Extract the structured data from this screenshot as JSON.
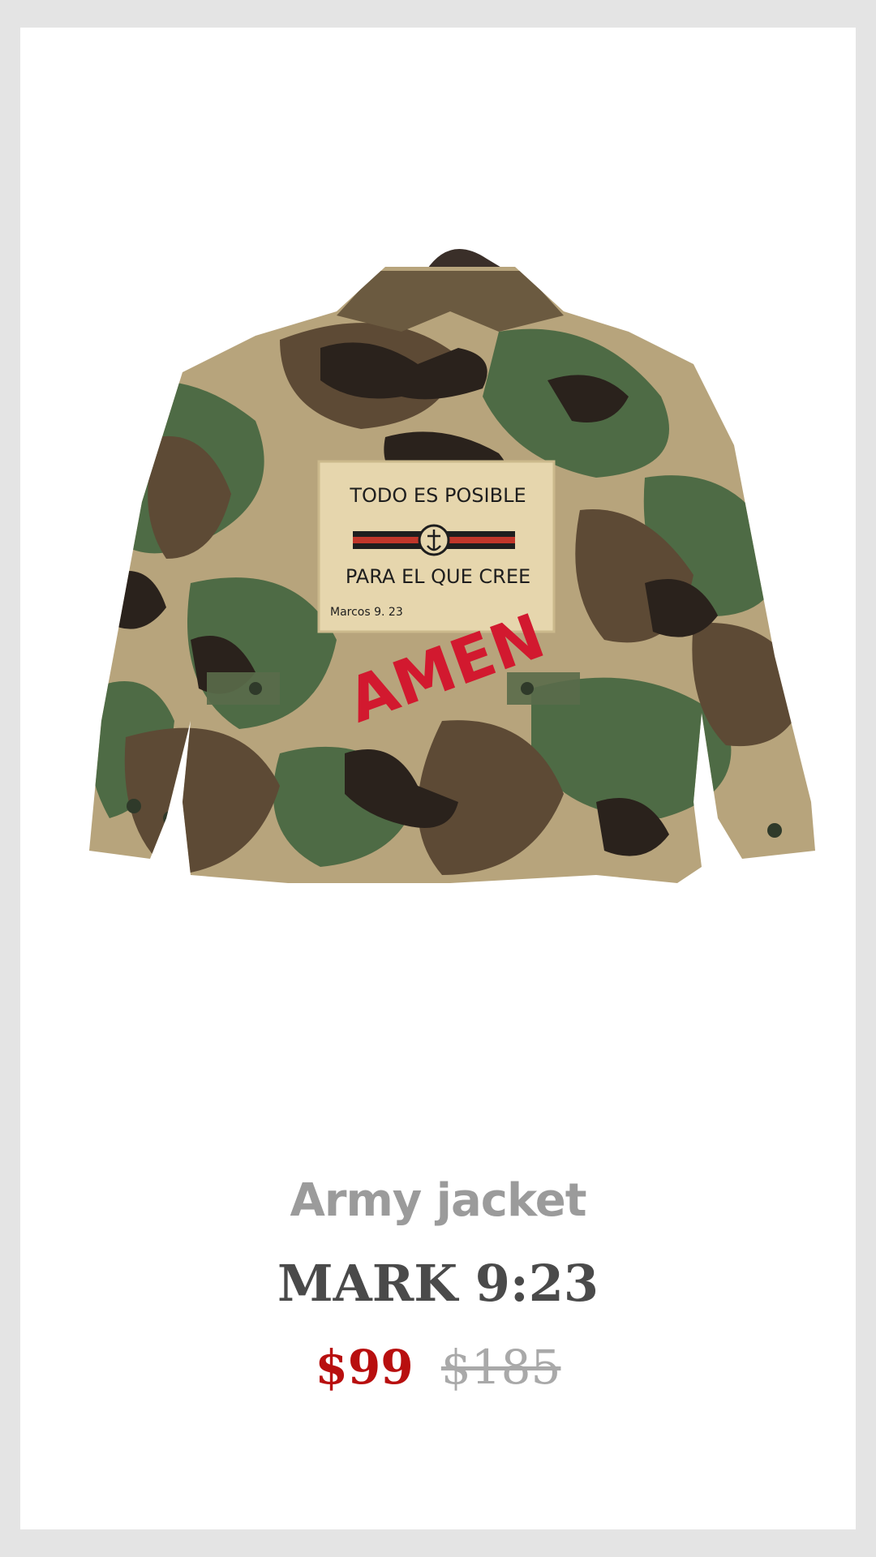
{
  "product": {
    "category": "Army jacket",
    "title": "MARK 9:23",
    "price": "$99",
    "original_price": "$185",
    "image": {
      "patch_line_1": "TODO ES POSIBLE",
      "patch_line_2": "PARA EL QUE CREE",
      "patch_reference": "Marcos 9. 23",
      "graffiti": "AMEN"
    }
  },
  "colors": {
    "background": "#e4e4e4",
    "card": "#ffffff",
    "category_text": "#9b9b9b",
    "title_text": "#4a4a4a",
    "sale_price": "#b80f0f",
    "original_price": "#a9a9a9",
    "camo_tan": "#b7a47c",
    "camo_green": "#4e6b45",
    "camo_brown": "#5d4a35",
    "camo_black": "#2a221c",
    "patch": "#e6d6ad",
    "graffiti": "#d2192f"
  }
}
